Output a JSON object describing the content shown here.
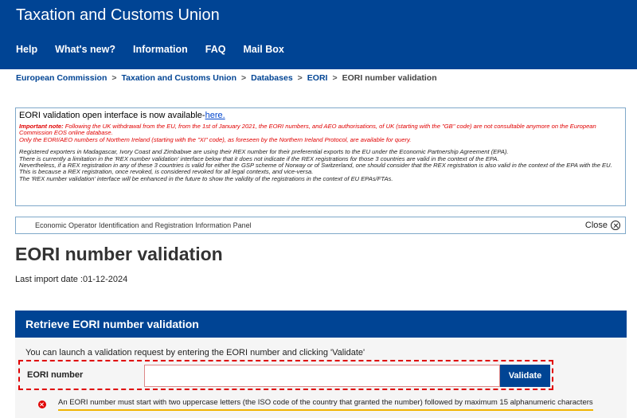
{
  "header": {
    "title": "Taxation and Customs Union",
    "nav": [
      "Help",
      "What's new?",
      "Information",
      "FAQ",
      "Mail Box"
    ]
  },
  "breadcrumb": {
    "items": [
      "European Commission",
      "Taxation and Customs Union",
      "Databases",
      "EORI"
    ],
    "current": "EORI number validation",
    "separator": ">"
  },
  "notice": {
    "headline": "EORI validation open interface is now available-",
    "headline_link": "here.",
    "important_label": "Important note:",
    "important_text": " Following the UK withdrawal from the EU, from the 1st of January 2021, the EORI numbers, and AEO authorisations, of UK (starting with the \"GB\" code) are not consultable anymore on the European Commission EOS online database.",
    "ni_text": "Only the EORI/AEO numbers of Northern Ireland (starting with the \"XI\" code), as foreseen by the Northern Ireland Protocol, are available for query.",
    "rex_lines": [
      "Registered exporters in Madagascar, Ivory Coast and Zimbabwe are using their REX number for their preferential exports to the EU under the Economic Partnership Agreement (EPA).",
      "There is currently a limitation in the 'REX number validation' interface below that it does not indicate if the REX registrations for those 3 countries are valid in the context of the EPA.",
      "Nevertheless, if a REX registration in any of these 3 countries is valid for either the GSP scheme of Norway or of Switzerland, one should consider that the REX registration is also valid in the context of the EPA with the EU. This is because a REX registration, once revoked, is considered revoked for all legal contexts, and vice-versa.",
      "The 'REX number validation' interface will be enhanced in the future to show the validity of the registrations in the context of EU EPAs/FTAs."
    ]
  },
  "panel": {
    "title": "Economic Operator Identification and Registration Information Panel",
    "close_label": "Close"
  },
  "page": {
    "title": "EORI number validation",
    "import_date": "Last import date :01-12-2024"
  },
  "form": {
    "header": "Retrieve EORI number validation",
    "intro": "You can launch a validation request by entering the EORI number and clicking 'Validate'",
    "field_label": "EORI number",
    "field_value": "",
    "button_label": "Validate",
    "error_text": "An EORI number must start with two uppercase letters (the ISO code of the country that granted the number) followed by maximum 15 alphanumeric characters"
  },
  "colors": {
    "brand_blue": "#004494",
    "error_red": "#e00000",
    "highlight_yellow": "#f0b400"
  }
}
